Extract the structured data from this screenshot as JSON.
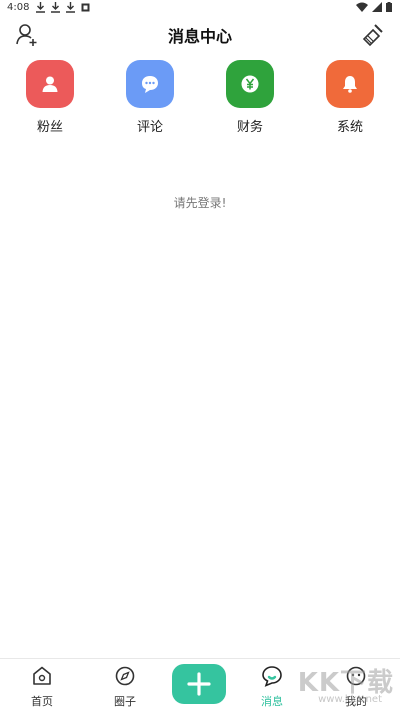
{
  "status_bar": {
    "time": "4:08"
  },
  "header": {
    "title": "消息中心"
  },
  "categories": [
    {
      "label": "粉丝",
      "color": "#ec5a5a",
      "icon": "user-icon"
    },
    {
      "label": "评论",
      "color": "#6b9bf6",
      "icon": "comment-icon"
    },
    {
      "label": "财务",
      "color": "#2fa33c",
      "icon": "yen-icon"
    },
    {
      "label": "系统",
      "color": "#f06a3a",
      "icon": "bell-icon"
    }
  ],
  "main": {
    "login_prompt": "请先登录!"
  },
  "tabbar": {
    "items": [
      {
        "label": "首页"
      },
      {
        "label": "圈子"
      },
      {
        "label": "消息"
      },
      {
        "label": "我的"
      }
    ],
    "accent_color": "#35c49f"
  },
  "watermark": {
    "text": "KK下载",
    "sub": "www.kkx.net"
  }
}
